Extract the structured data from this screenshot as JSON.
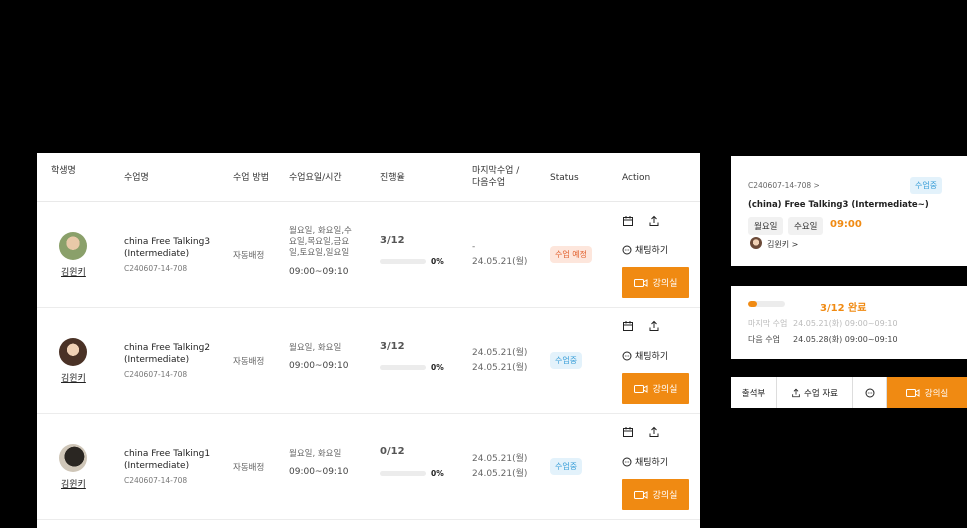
{
  "table": {
    "headers": {
      "student": "학생명",
      "course": "수업명",
      "method": "수업 방법",
      "schedule": "수업요일/시간",
      "progress": "진행율",
      "last_next": "마지막수업 /\n다음수업",
      "status": "Status",
      "action": "Action"
    },
    "rows": [
      {
        "student": "김윈키",
        "title": "china Free Talking3\n(Intermediate)",
        "code": "C240607-14-708",
        "method": "자동배정",
        "days": "월요일, 화요일,수\n요일,목요일,금요\n일,토요일,일요일",
        "time": "09:00~09:10",
        "progress": "3/12",
        "progress_value": 0,
        "percent": "0%",
        "last_next": "-\n24.05.21(월)",
        "status": "수업 예정",
        "chat": "채팅하기",
        "room": "강의실"
      },
      {
        "student": "김윈키",
        "title": "china Free Talking2\n(Intermediate)",
        "code": "C240607-14-708",
        "method": "자동배정",
        "days": "월요일, 화요일",
        "time": "09:00~09:10",
        "progress": "3/12",
        "progress_value": 0,
        "percent": "0%",
        "last_next": "24.05.21(월)\n24.05.21(월)",
        "status": "수업중",
        "chat": "채팅하기",
        "room": "강의실"
      },
      {
        "student": "김윈키",
        "title": "china Free Talking1\n (Intermediate)",
        "code": "C240607-14-708",
        "method": "자동배정",
        "days": "월요일, 화요일",
        "time": "09:00~09:10",
        "progress": "0/12",
        "progress_value": 0,
        "percent": "0%",
        "last_next": "24.05.21(월)\n24.05.21(월)",
        "status": "수업중",
        "chat": "채팅하기",
        "room": "강의실"
      }
    ]
  },
  "card1": {
    "code": "C240607-14-708 >",
    "status": "수업중",
    "title": "(china) Free Talking3 (Intermediate~)",
    "day1": "월요일",
    "day2": "수요일",
    "time": "09:00",
    "student": "김윈키 >"
  },
  "card2": {
    "progress": "3/12 완료",
    "progress_value": 0.25,
    "last_label": "마지막 수업",
    "last_value": "24.05.21(화) 09:00~09:10",
    "next_label": "다음 수업",
    "next_value": "24.05.28(화) 09:00~09:10"
  },
  "card3": {
    "attendance": "출석부",
    "material": "수업 자료",
    "room": "강의실"
  },
  "colors": {
    "accent": "#f08a12",
    "reserved_bg": "#fde6dc",
    "reserved_fg": "#e2612e",
    "ongoing_bg": "#e3f2fb",
    "ongoing_fg": "#3a9fd8"
  }
}
